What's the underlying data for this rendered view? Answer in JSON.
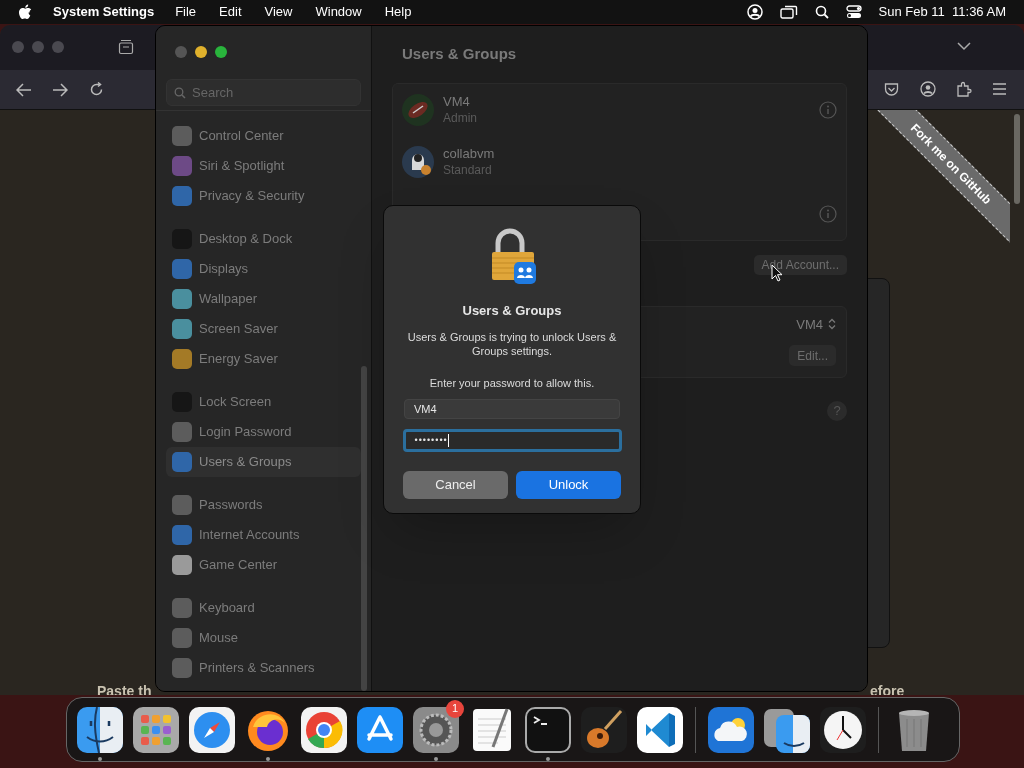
{
  "menu_bar": {
    "app": "System Settings",
    "menus": [
      "File",
      "Edit",
      "View",
      "Window",
      "Help"
    ],
    "clock": "Sun Feb 11  11:36 AM"
  },
  "browser": {
    "ribbon": "Fork me on GitHub",
    "page_text": [
      "Paste th",
      "efore"
    ]
  },
  "settings": {
    "search": {
      "placeholder": "Search"
    },
    "sidebar": [
      [
        {
          "label": "Control Center",
          "color": "#5c5c5c",
          "selected": false
        },
        {
          "label": "Siri & Spotlight",
          "color": "#6d4a86",
          "selected": false
        },
        {
          "label": "Privacy & Security",
          "color": "#2f66a8",
          "selected": false
        }
      ],
      [
        {
          "label": "Desktop & Dock",
          "color": "#161616",
          "selected": false
        },
        {
          "label": "Displays",
          "color": "#2f66a8",
          "selected": false
        },
        {
          "label": "Wallpaper",
          "color": "#4a8f9e",
          "selected": false
        },
        {
          "label": "Screen Saver",
          "color": "#4a8f9e",
          "selected": false
        },
        {
          "label": "Energy Saver",
          "color": "#a47a26",
          "selected": false
        }
      ],
      [
        {
          "label": "Lock Screen",
          "color": "#161616",
          "selected": false
        },
        {
          "label": "Login Password",
          "color": "#5c5c5c",
          "selected": false
        },
        {
          "label": "Users & Groups",
          "color": "#2f66a8",
          "selected": true
        }
      ],
      [
        {
          "label": "Passwords",
          "color": "#5c5c5c",
          "selected": false
        },
        {
          "label": "Internet Accounts",
          "color": "#2f66a8",
          "selected": false
        },
        {
          "label": "Game Center",
          "color": "#9a9a9a",
          "selected": false
        }
      ],
      [
        {
          "label": "Keyboard",
          "color": "#5c5c5c",
          "selected": false
        },
        {
          "label": "Mouse",
          "color": "#5c5c5c",
          "selected": false
        },
        {
          "label": "Printers & Scanners",
          "color": "#5c5c5c",
          "selected": false
        }
      ]
    ],
    "title": "Users & Groups",
    "users": [
      {
        "name": "VM4",
        "role": "Admin",
        "kind": "ball",
        "info": true
      },
      {
        "name": "collabvm",
        "role": "Standard",
        "kind": "bird",
        "info": false
      },
      {
        "kind": "blank",
        "info": true
      }
    ],
    "add_account": "Add Account...",
    "auto_login": "VM4",
    "edit_button": "Edit...",
    "help": "?"
  },
  "dialog": {
    "title": "Users & Groups",
    "message": "Users & Groups is trying to unlock Users & Groups settings.",
    "prompt": "Enter your password to allow this.",
    "username": "VM4",
    "password": "••••••••",
    "cancel": "Cancel",
    "unlock": "Unlock"
  },
  "dock": [
    {
      "kind": "finder",
      "running": true
    },
    {
      "kind": "launchpad",
      "running": false
    },
    {
      "kind": "safari",
      "running": false
    },
    {
      "kind": "firefox",
      "running": true
    },
    {
      "kind": "chrome",
      "running": false
    },
    {
      "kind": "appstore",
      "running": false
    },
    {
      "kind": "settings",
      "running": true,
      "badge": "1"
    },
    {
      "kind": "textedit",
      "running": false
    },
    {
      "kind": "terminal",
      "running": true
    },
    {
      "kind": "guitar",
      "running": false
    },
    {
      "kind": "vscode",
      "running": false
    },
    {
      "kind": "separator"
    },
    {
      "kind": "weather",
      "running": false
    },
    {
      "kind": "migration",
      "running": false
    },
    {
      "kind": "clock",
      "running": false
    },
    {
      "kind": "separator"
    },
    {
      "kind": "trash",
      "running": false
    }
  ]
}
